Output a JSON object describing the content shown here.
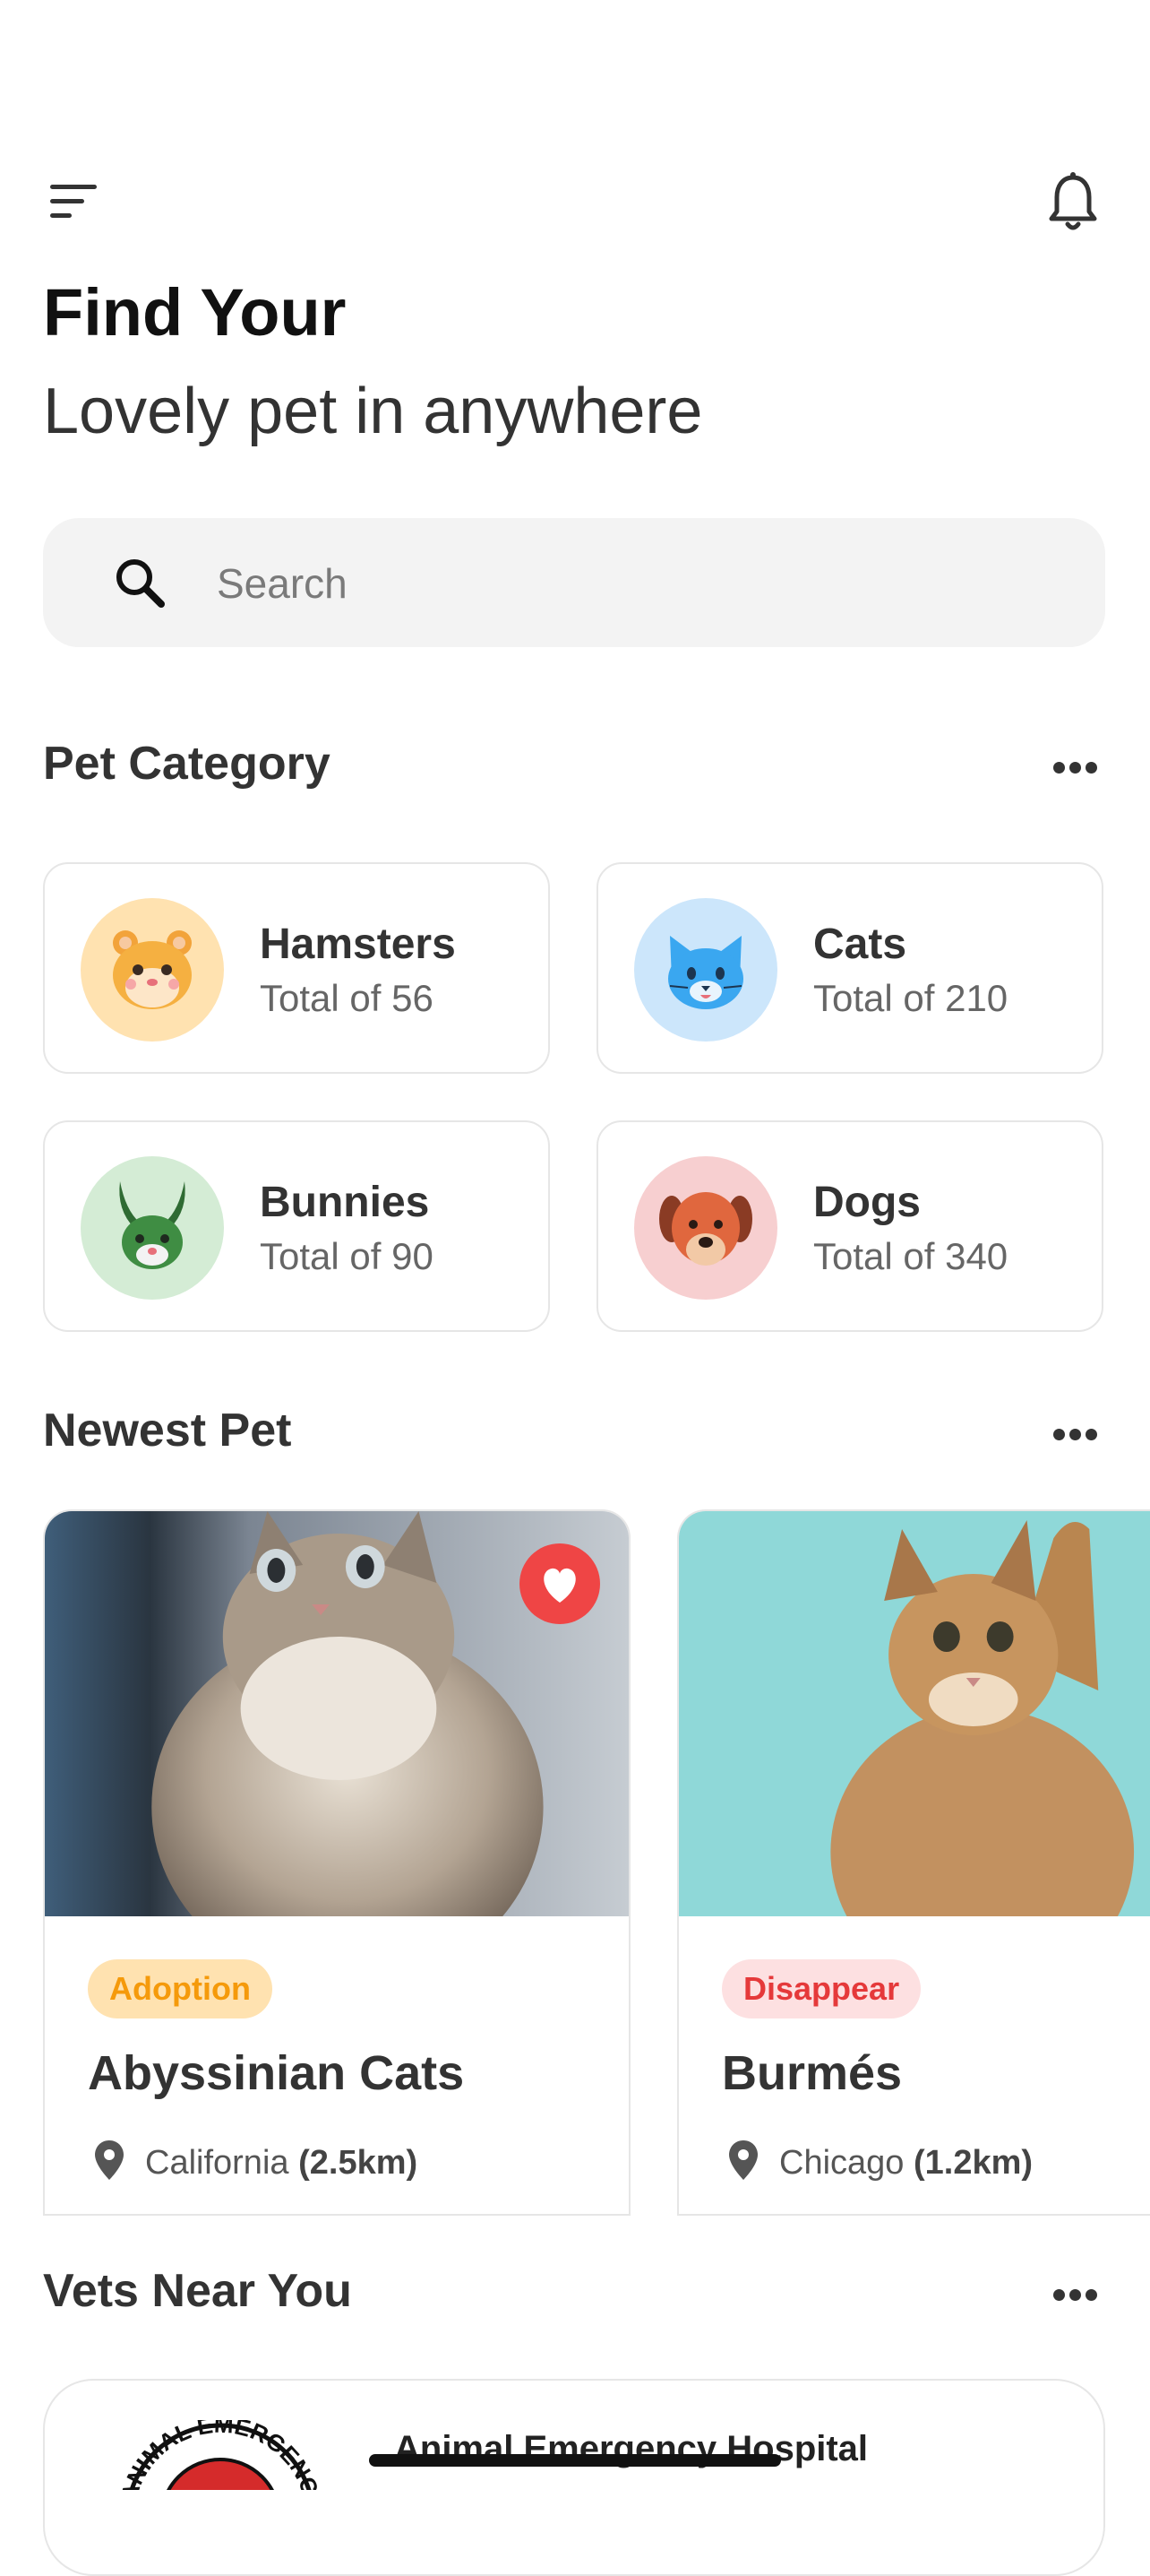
{
  "header": {
    "title_line1": "Find Your",
    "title_line2": "Lovely pet in anywhere"
  },
  "icons": {
    "menu": "menu-lines-icon",
    "notification": "bell-icon",
    "search": "search-icon",
    "more": "more-horizontal-icon",
    "favorite": "heart-icon",
    "location": "location-pin-icon"
  },
  "search": {
    "placeholder": "Search"
  },
  "categories_section": {
    "title": "Pet Category",
    "items": [
      {
        "name": "Hamsters",
        "total": "Total of 56",
        "circle_color": "#ffe2b0"
      },
      {
        "name": "Cats",
        "total": "Total of 210",
        "circle_color": "#cce6fb"
      },
      {
        "name": "Bunnies",
        "total": "Total of 90",
        "circle_color": "#d4ecd5"
      },
      {
        "name": "Dogs",
        "total": "Total of 340",
        "circle_color": "#f7cfd0"
      }
    ]
  },
  "newest_section": {
    "title": "Newest Pet",
    "pets": [
      {
        "badge": "Adoption",
        "name": "Abyssinian Cats",
        "city": "California",
        "distance": "(2.5km)",
        "favorited": true
      },
      {
        "badge": "Disappear",
        "name": "Burmés",
        "city": "Chicago",
        "distance": "(1.2km)",
        "favorited": false
      }
    ]
  },
  "vets_section": {
    "title": "Vets Near You",
    "vets": [
      {
        "name": "Animal Emergency Hospital",
        "logo_text": "ANIMAL EMERGENCY"
      }
    ]
  },
  "colors": {
    "adoption_badge_bg": "#ffe2b0",
    "adoption_badge_text": "#f59a0b",
    "disappear_badge_bg": "#fde0e1",
    "disappear_badge_text": "#e5393a",
    "favorite": "#ef4545"
  }
}
